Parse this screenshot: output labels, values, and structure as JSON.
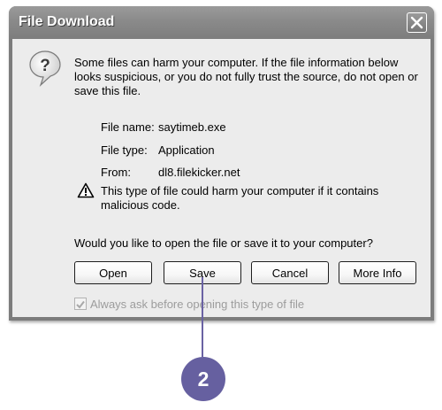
{
  "dialog": {
    "title": "File Download",
    "close_glyph": "✕",
    "intro": "Some files can harm your computer. If the file information below looks suspicious, or you do not fully trust the source, do not open or save this file.",
    "file_name_label": "File name:",
    "file_name": "saytimeb.exe",
    "file_type_label": "File type:",
    "file_type": "Application",
    "from_label": "From:",
    "from": "dl8.filekicker.net",
    "warning": "This type of file could harm your computer if it contains malicious code.",
    "question": "Would you like to open the file or save it to your computer?",
    "buttons": {
      "open": "Open",
      "save": "Save",
      "cancel": "Cancel",
      "more_info": "More Info"
    },
    "checkbox": {
      "label": "Always ask before opening this type of file",
      "checked": true,
      "enabled": false
    },
    "icons": {
      "question": "question-balloon-icon",
      "warning": "warning-triangle-icon",
      "close": "close-icon"
    }
  },
  "callout": {
    "number": "2",
    "color": "#6660a0"
  }
}
